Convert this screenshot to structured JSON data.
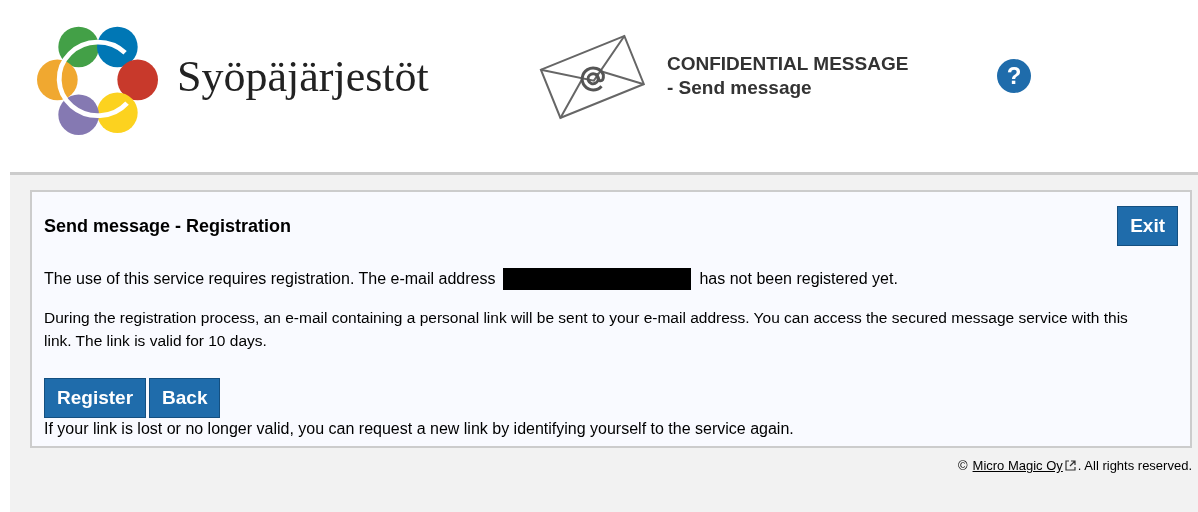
{
  "header": {
    "logo_text": "Syöpäjärjestöt",
    "title": "CONFIDENTIAL MESSAGE",
    "subtitle": "- Send message",
    "help": "?"
  },
  "panel": {
    "title": "Send message - Registration",
    "exit_button": "Exit",
    "intro_before": "The use of this service requires registration. The e-mail address",
    "intro_after": "has not been registered yet.",
    "info": "During the registration process, an e-mail containing a personal link will be sent to your e-mail address. You can access the secured message service with this link. The link is valid for 10 days.",
    "buttons": [
      "Register",
      "Back"
    ],
    "note": "If your link is lost or no longer valid, you can request a new link by identifying yourself to the service again."
  },
  "footer": {
    "symbol": "©",
    "link": "Micro Magic Oy",
    "rest": ". All rights reserved."
  }
}
